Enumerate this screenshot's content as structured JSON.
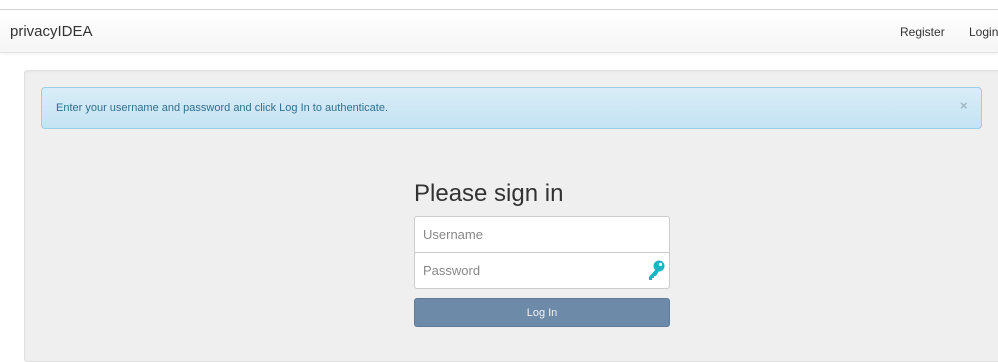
{
  "navbar": {
    "brand": "privacyIDEA",
    "links": {
      "register": "Register",
      "login": "Login"
    }
  },
  "alert": {
    "message": "Enter your username and password and click Log In to authenticate.",
    "close": "×"
  },
  "signin": {
    "title": "Please sign in",
    "username_placeholder": "Username",
    "password_placeholder": "Password",
    "key_icon": "key-icon",
    "submit_label": "Log In"
  },
  "colors": {
    "alert_bg": "#d9edf7",
    "alert_text": "#31708f",
    "button_bg": "#6d8aa8",
    "key_icon": "#1ab5c4"
  }
}
